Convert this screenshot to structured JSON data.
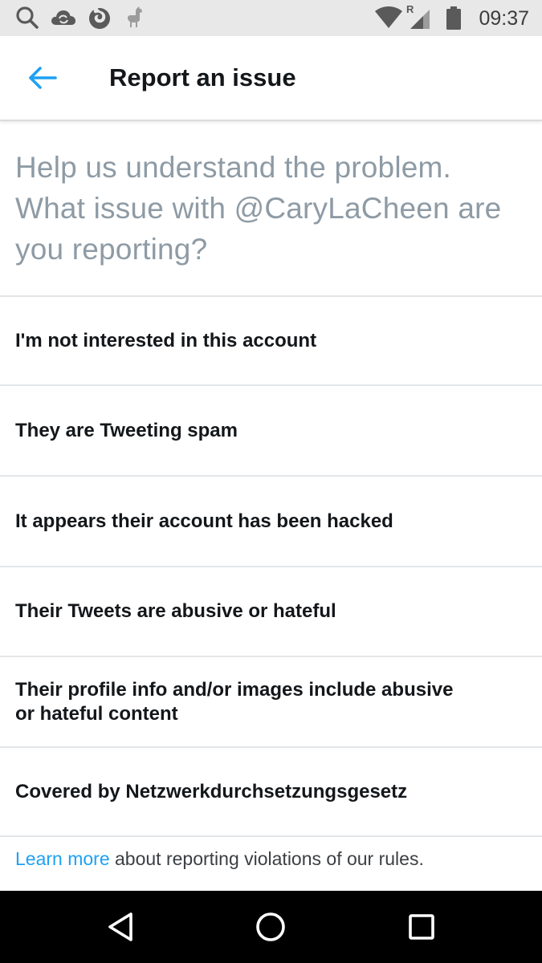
{
  "status_bar": {
    "time": "09:37",
    "left_icons": [
      "search-icon",
      "cloud-sync-icon",
      "firefox-icon",
      "llama-icon"
    ],
    "right_icons": [
      "wifi-icon",
      "signal-roaming-icon",
      "battery-icon"
    ],
    "roaming_indicator": "R"
  },
  "header": {
    "back_icon": "arrow-left-icon",
    "title": "Report an issue"
  },
  "prompt": "Help us understand the problem. What issue with @CaryLaCheen are you reporting?",
  "options": [
    {
      "label": "I'm not interested in this account"
    },
    {
      "label": "They are Tweeting spam"
    },
    {
      "label": "It appears their account has been hacked"
    },
    {
      "label": "Their Tweets are abusive or hateful"
    },
    {
      "label": "Their profile info and/or images include abusive or hateful content"
    },
    {
      "label": "Covered by Netzwerkdurchsetzungsgesetz"
    }
  ],
  "footer": {
    "link_text": "Learn more",
    "rest_text": " about reporting violations of our rules."
  },
  "nav_bar": {
    "buttons": [
      "back-triangle-icon",
      "home-circle-icon",
      "recents-square-icon"
    ]
  },
  "colors": {
    "accent": "#1da1f2",
    "prompt_text": "#8e9ba5",
    "primary_text": "#14171a",
    "status_bar_bg": "#e8e8e8",
    "nav_bar_bg": "#000000"
  }
}
